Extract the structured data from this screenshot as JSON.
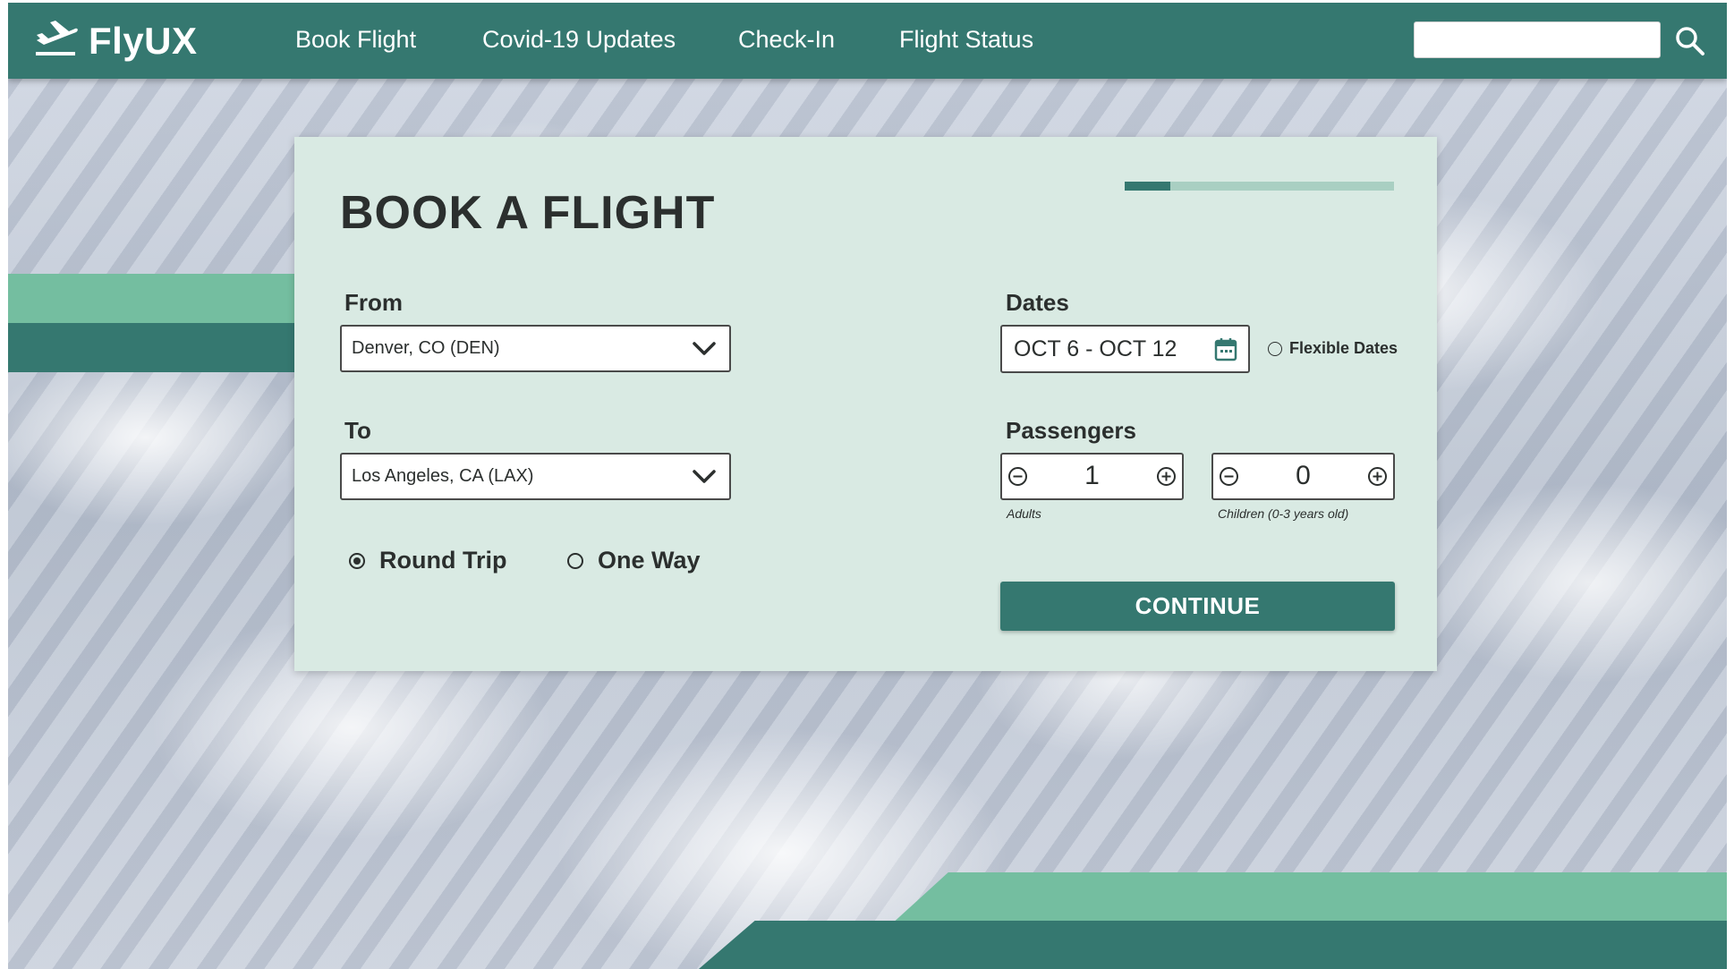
{
  "brand": {
    "name": "FlyUX",
    "icon": "airplane-takeoff-icon"
  },
  "nav": {
    "links": [
      "Book Flight",
      "Covid-19 Updates",
      "Check-In",
      "Flight Status"
    ]
  },
  "search": {
    "value": "",
    "icon": "search-icon"
  },
  "booking": {
    "title": "BOOK A FLIGHT",
    "progress_fraction": 0.17,
    "from": {
      "label": "From",
      "value": "Denver, CO (DEN)"
    },
    "to": {
      "label": "To",
      "value": "Los Angeles, CA (LAX)"
    },
    "trip_type": {
      "options": [
        "Round Trip",
        "One Way"
      ],
      "selected": "Round Trip"
    },
    "dates": {
      "label": "Dates",
      "value": "OCT 6 - OCT 12",
      "flexible_label": "Flexible Dates",
      "flexible": false
    },
    "passengers": {
      "label": "Passengers",
      "adults": {
        "value": "1",
        "caption": "Adults"
      },
      "children": {
        "value": "0",
        "caption": "Children (0-3 years old)"
      }
    },
    "continue_label": "CONTINUE"
  },
  "colors": {
    "primary": "#357870",
    "accent": "#74bea0",
    "card": "#d9eae3",
    "progress_track": "#a9cfc2"
  }
}
